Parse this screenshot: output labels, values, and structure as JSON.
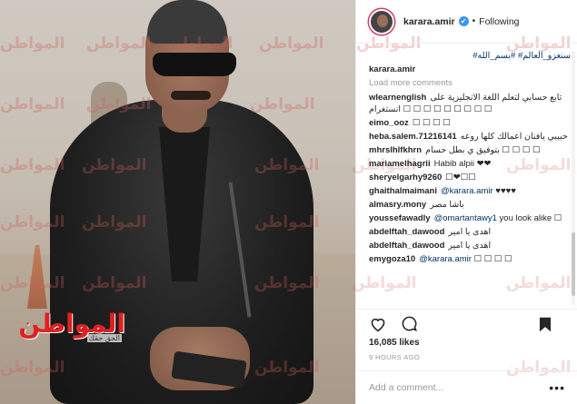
{
  "post": {
    "account": "karara.amir",
    "follow_status": "Following",
    "separator": "•",
    "verified_mark": "✔",
    "caption_tags": "سنغزو_العالم# #بسم_الله#",
    "caption_user": "karara.amir",
    "load_more": "Load more comments",
    "comments": [
      {
        "user": "wlearnenglish",
        "text": "تابع حسابي لتعلم اللغة الانجليزية على ☐ ☐ ☐ ☐ ☐ ☐ ☐ ☐ ☐ انستغرام"
      },
      {
        "user": "eimo_ooz",
        "text": "☐ ☐ ☐ ☐"
      },
      {
        "user": "heba.salem.71216141",
        "text": "حبيبي يافنان اعمالك كلها روعه"
      },
      {
        "user": "mhrslhlfkhrn",
        "text": "بتوفيق ي بطل حسام ☐ ☐ ☐ ☐"
      },
      {
        "user": "mariamelhagrii",
        "text": "Habib alpii ❤❤"
      },
      {
        "user": "sheryelgarhy9260",
        "text": "☐❤☐☐"
      },
      {
        "user": "ghaithalmaimani",
        "mention": "@karara.amir",
        "text": "♥♥♥♥"
      },
      {
        "user": "almasry.mony",
        "text": "باشا مصر"
      },
      {
        "user": "youssefawadly",
        "mention": "@omartantawy1",
        "text": "you look alike ☐"
      },
      {
        "user": "abdelftah_dawood",
        "text": "اهدى يا امير"
      },
      {
        "user": "abdelftah_dawood",
        "text": "اهدى يا امير"
      },
      {
        "user": "emygoza10",
        "mention": "@karara.amir",
        "text": "☐ ☐ ☐ ☐"
      }
    ],
    "likes": "16,085 likes",
    "time_ago": "9 HOURS AGO",
    "add_comment_placeholder": "Add a comment...",
    "more_icon": "•••"
  },
  "photo": {
    "watermark": "المواطن",
    "logo_text": "المواطن",
    "logo_sub": "الحق حقك"
  },
  "icons": [
    "heart-icon",
    "comment-icon",
    "bookmark-icon",
    "verified-icon",
    "more-options-icon"
  ],
  "colors": {
    "link": "#003569",
    "verified": "#3897f0",
    "muted": "#999999",
    "watermark": "#cd5c5c",
    "logo": "#e02020"
  }
}
